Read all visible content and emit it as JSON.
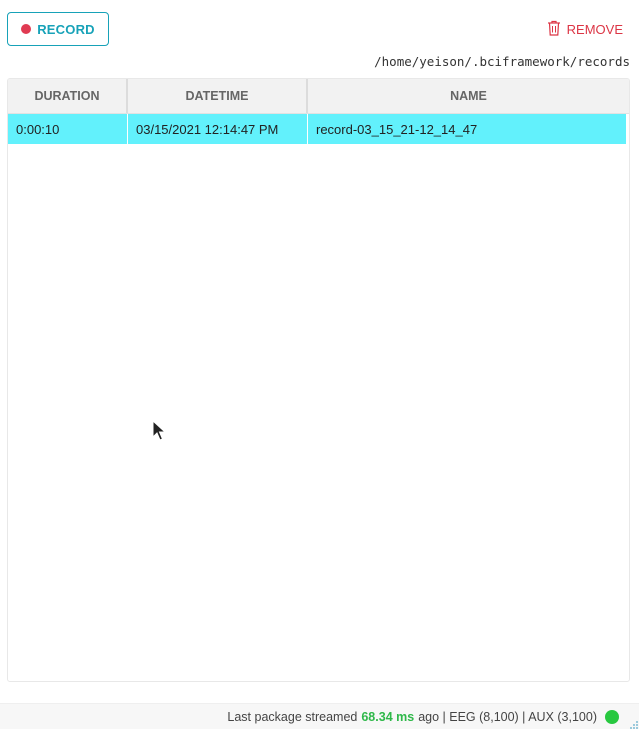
{
  "toolbar": {
    "record_label": "RECORD",
    "remove_label": "REMOVE",
    "path": "/home/yeison/.bciframework/records"
  },
  "table": {
    "columns": [
      "DURATION",
      "DATETIME",
      "NAME"
    ],
    "rows": [
      {
        "duration": "0:00:10",
        "datetime": "03/15/2021 12:14:47 PM",
        "name": "record-03_15_21-12_14_47",
        "selected": true
      }
    ]
  },
  "status": {
    "prefix": "Last package streamed",
    "latency": "68.34 ms",
    "suffix": "ago | EEG (8,100) | AUX (3,100)",
    "indicator_color": "#28c840"
  },
  "colors": {
    "accent": "#17a2b8",
    "danger": "#dc3545",
    "selected_row": "#62f1fc",
    "record_dot": "#e03a52"
  },
  "icons": {
    "record": "record-dot-icon",
    "remove": "trash-icon",
    "status": "status-dot-icon"
  }
}
